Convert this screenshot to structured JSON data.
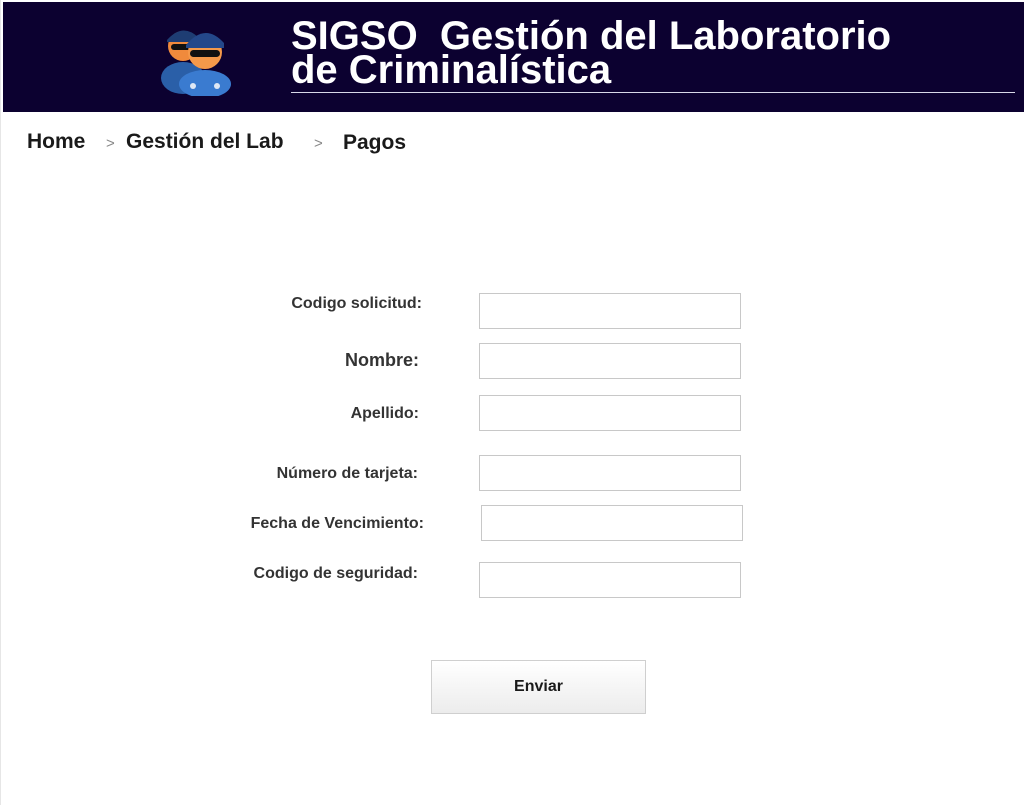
{
  "header": {
    "logo_icon": "police-officers-icon",
    "title_line1": "SIGSO  Gestión del Laboratorio",
    "title_line2": "de Criminalística",
    "background_color": "#0c0130"
  },
  "breadcrumb": {
    "items": [
      "Home",
      "Gestión del Lab",
      "Pagos"
    ],
    "separator": ">"
  },
  "form": {
    "fields": [
      {
        "label": "Codigo solicitud:",
        "value": "",
        "placeholder": ""
      },
      {
        "label": "Nombre:",
        "value": "",
        "placeholder": ""
      },
      {
        "label": "Apellido:",
        "value": "",
        "placeholder": ""
      },
      {
        "label": "Número de tarjeta:",
        "value": "",
        "placeholder": ""
      },
      {
        "label": "Fecha de Vencimiento:",
        "value": "",
        "placeholder": ""
      },
      {
        "label": "Codigo de seguridad:",
        "value": "",
        "placeholder": ""
      }
    ],
    "submit_label": "Enviar"
  }
}
